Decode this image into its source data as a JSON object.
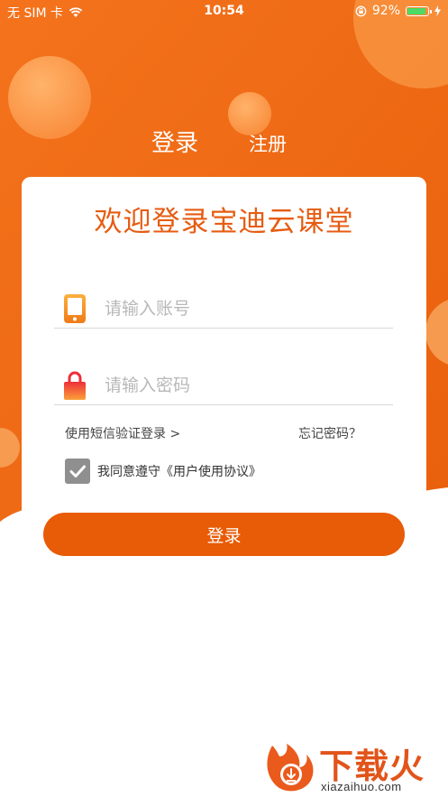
{
  "status_bar": {
    "carrier": "无 SIM 卡",
    "time": "10:54",
    "battery_percent": "92%",
    "battery_level": 0.92,
    "icons": [
      "wifi-icon",
      "orientation-lock-icon",
      "battery-icon",
      "charging-icon"
    ]
  },
  "tabs": {
    "login": "登录",
    "register": "注册"
  },
  "card": {
    "welcome": "欢迎登录宝迪云课堂",
    "account": {
      "placeholder": "请输入账号",
      "value": "",
      "icon": "phone-icon"
    },
    "password": {
      "placeholder": "请输入密码",
      "value": "",
      "icon": "lock-icon"
    },
    "sms_login": "使用短信验证登录 >",
    "forgot_password": "忘记密码？",
    "agree_text": "我同意遵守《用户使用协议》",
    "agree_checked": true
  },
  "login_button": "登录",
  "watermark": {
    "title": "下载火",
    "url": "xiazaihuo.com"
  },
  "colors": {
    "brand_orange": "#e85b07",
    "title_orange": "#e65c12",
    "checkbox_gray": "#8f8f8f"
  }
}
